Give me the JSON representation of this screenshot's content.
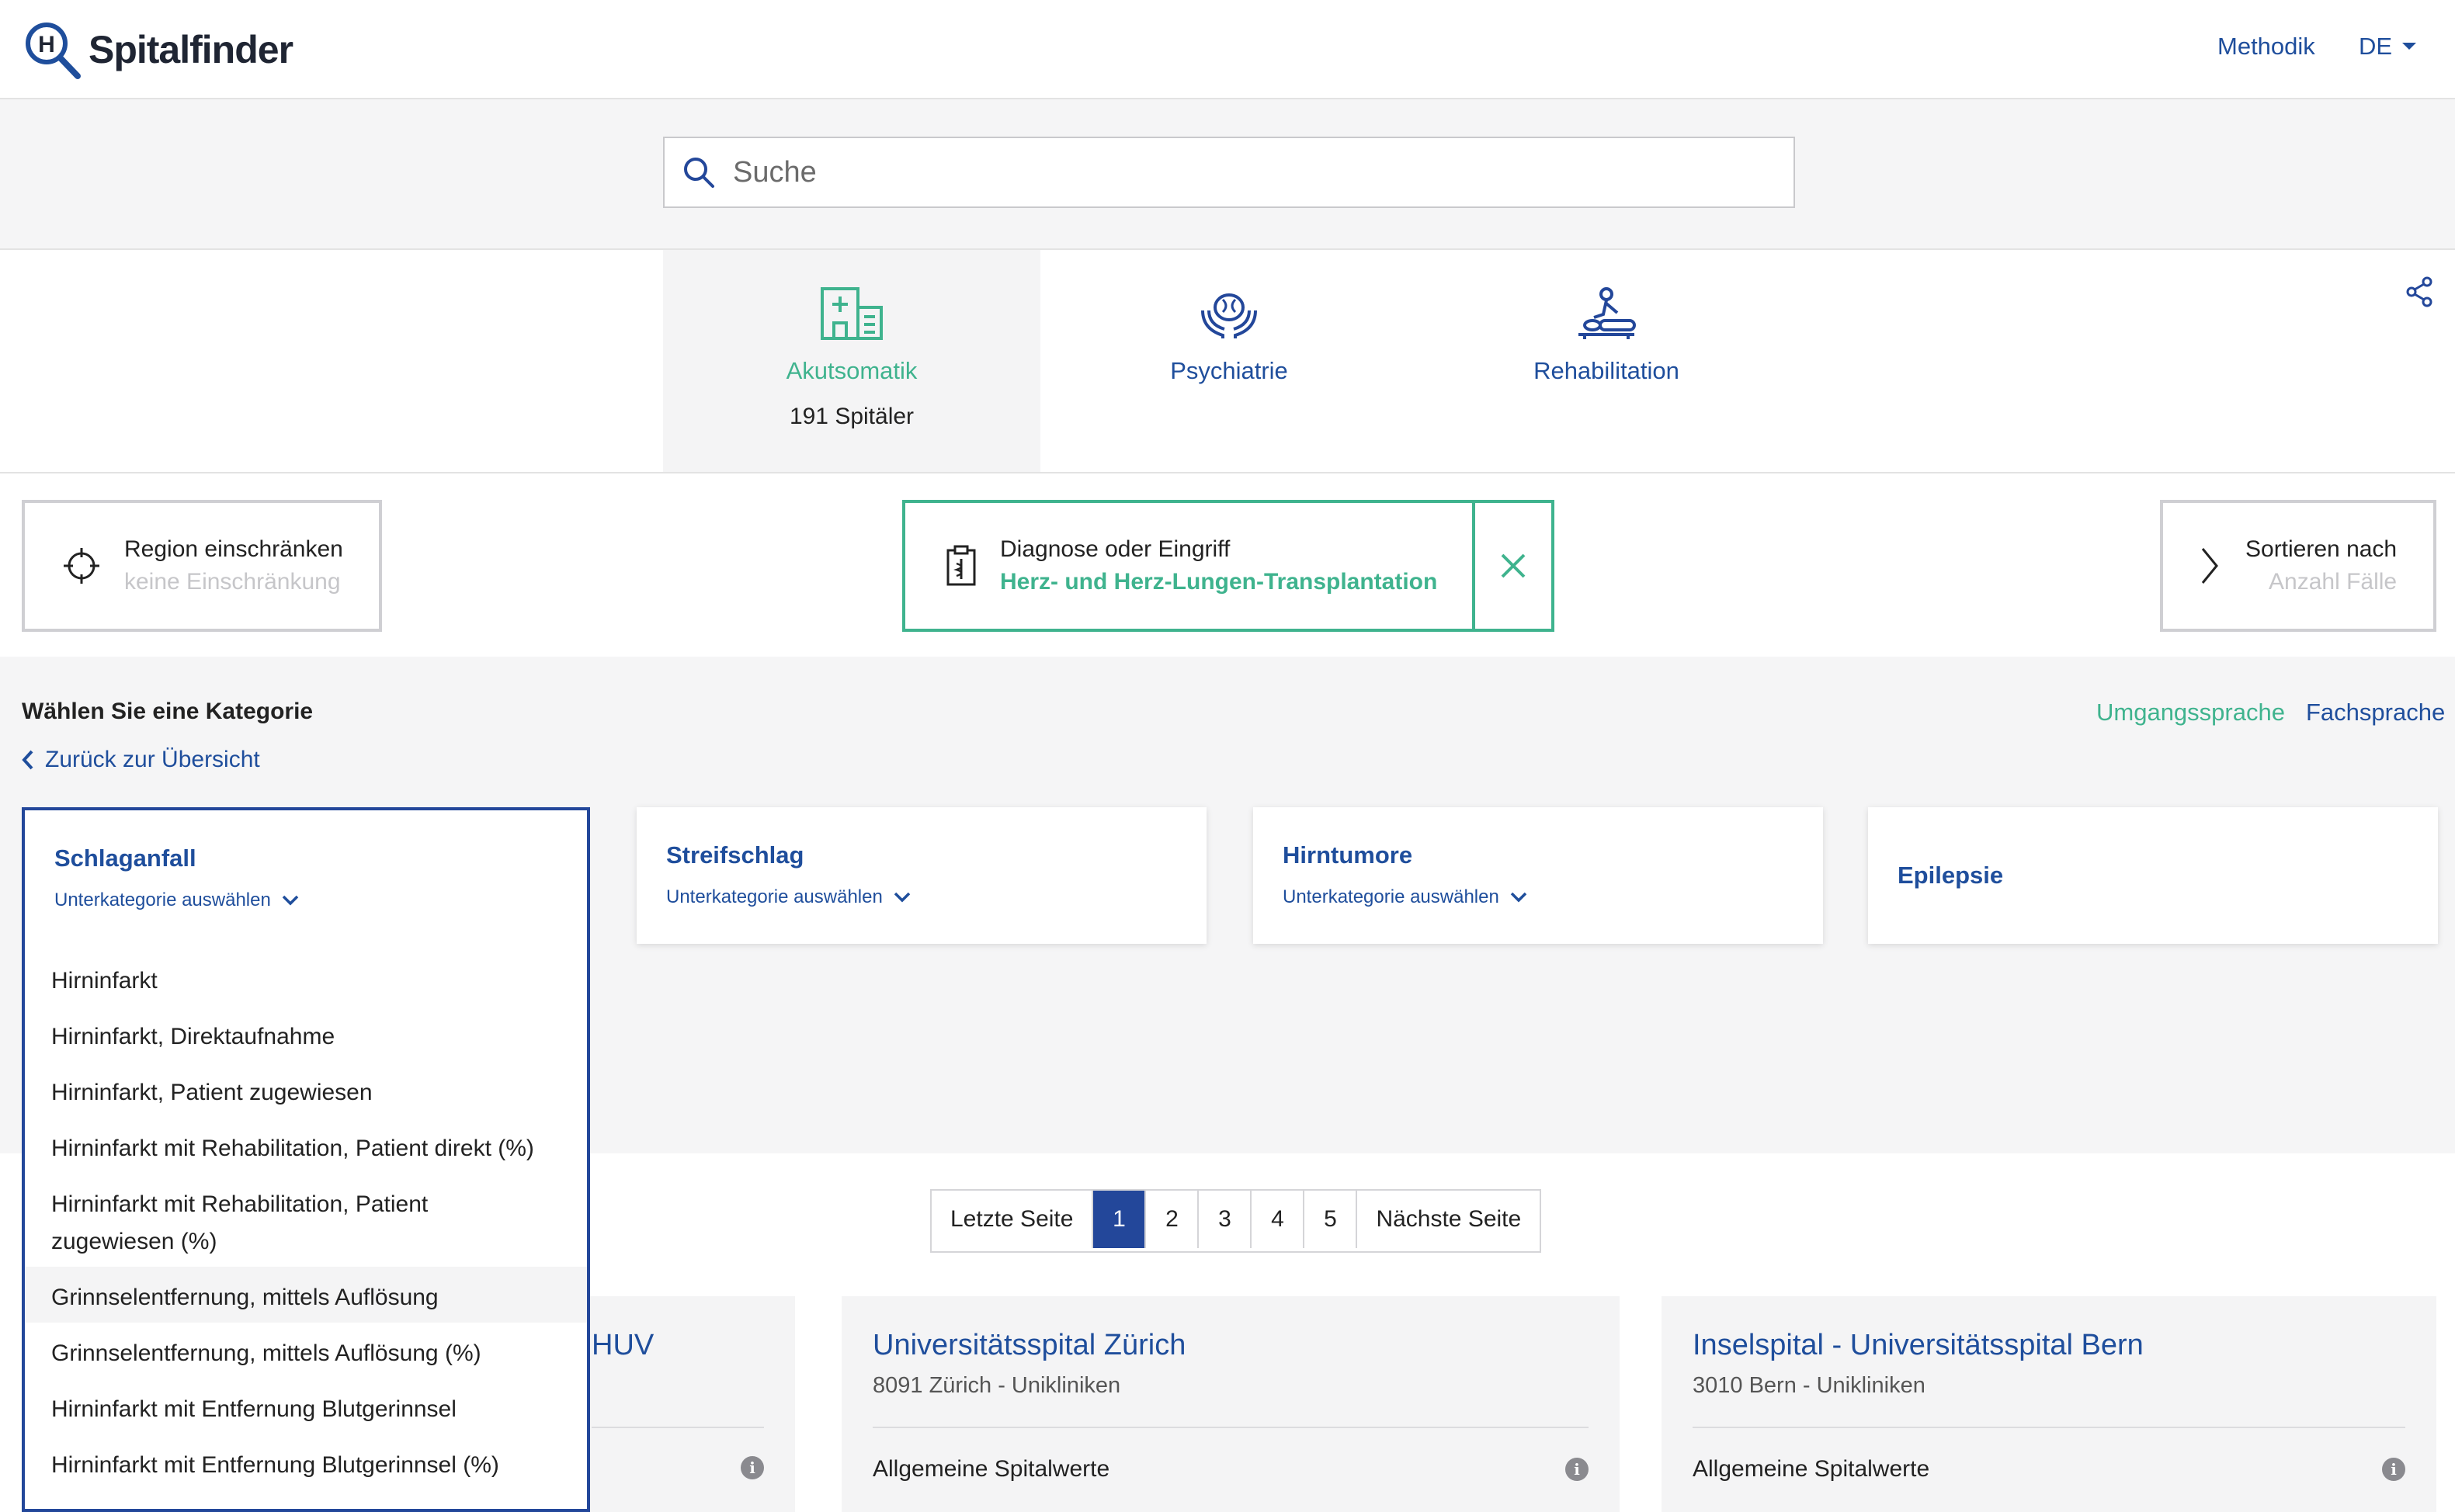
{
  "header": {
    "app_name": "Spitalfinder",
    "nav": {
      "methodik": "Methodik",
      "language": "DE"
    }
  },
  "search": {
    "placeholder": "Suche"
  },
  "categories": [
    {
      "label": "Akutsomatik",
      "count": "191 Spitäler",
      "icon": "hospital-icon",
      "active": true
    },
    {
      "label": "Psychiatrie",
      "icon": "brain-hands-icon"
    },
    {
      "label": "Rehabilitation",
      "icon": "massage-table-icon"
    }
  ],
  "filters": {
    "region": {
      "title": "Region einschränken",
      "value": "keine Einschränkung"
    },
    "diagnose": {
      "title": "Diagnose oder Eingriff",
      "value": "Herz- und Herz-Lungen-Transplantation"
    },
    "sort": {
      "title": "Sortieren nach",
      "value": "Anzahl Fälle"
    }
  },
  "category_section": {
    "title": "Wählen Sie eine Kategorie",
    "back_link": "Zurück zur Übersicht",
    "lang_common": "Umgangssprache",
    "lang_technical": "Fachsprache"
  },
  "cards": [
    {
      "title": "Schlaganfall",
      "sub": "Unterkategorie auswählen"
    },
    {
      "title": "Streifschlag",
      "sub": "Unterkategorie auswählen"
    },
    {
      "title": "Hirntumore",
      "sub": "Unterkategorie auswählen"
    },
    {
      "title": "Epilepsie"
    }
  ],
  "dropdown_items": [
    "Hirninfarkt",
    "Hirninfarkt, Direktaufnahme",
    "Hirninfarkt, Patient zugewiesen",
    "Hirninfarkt mit Rehabilitation, Patient direkt (%)",
    "Hirninfarkt mit Rehabilitation, Patient zugewiesen (%)",
    "Grinnselentfernung, mittels Auflösung",
    "Grinnselentfernung, mittels Auflösung (%)",
    "Hirninfarkt mit Entfernung Blutgerinnsel",
    "Hirninfarkt mit Entfernung Blutgerinnsel (%)"
  ],
  "pagination": {
    "prev": "Letzte Seite",
    "pages": [
      "1",
      "2",
      "3",
      "4",
      "5"
    ],
    "current": "1",
    "next": "Nächste Seite"
  },
  "results": [
    {
      "title_fragment": "HUV",
      "row_label": ""
    },
    {
      "title": "Universitätsspital Zürich",
      "sub": "8091 Zürich - Unikliniken",
      "row_label": "Allgemeine Spitalwerte"
    },
    {
      "title": "Inselspital - Universitätsspital Bern",
      "sub": "3010 Bern - Unikliniken",
      "row_label": "Allgemeine Spitalwerte"
    }
  ],
  "colors": {
    "primary_blue": "#23479a",
    "link_blue": "#1f4e9c",
    "accent_green": "#3fb38e"
  }
}
